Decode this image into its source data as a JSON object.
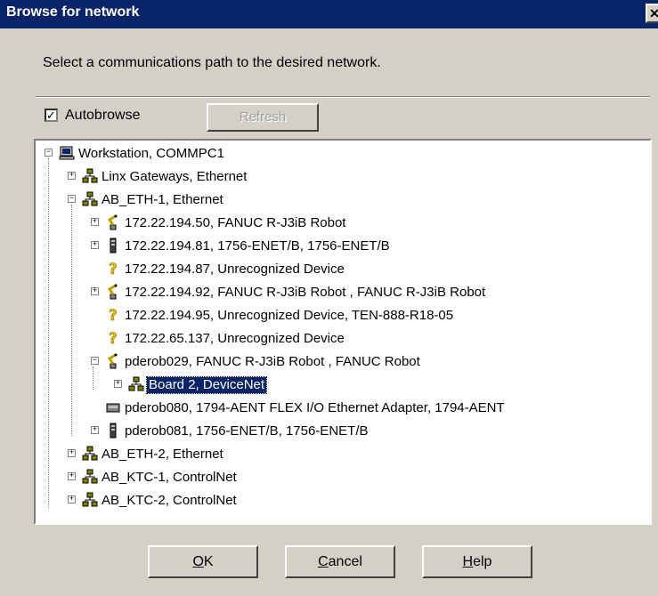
{
  "window": {
    "title": "Browse for network",
    "instruction": "Select a communications path to the desired network."
  },
  "options": {
    "autobrowse_label": "Autobrowse",
    "autobrowse_checked": true,
    "refresh_label": "Refresh"
  },
  "tree": {
    "nodes": [
      {
        "label": "Workstation, COMMPC1",
        "icon": "computer-icon",
        "expander": "minus"
      },
      {
        "label": "Linx Gateways, Ethernet",
        "icon": "network-icon",
        "expander": "plus"
      },
      {
        "label": "AB_ETH-1, Ethernet",
        "icon": "network-icon",
        "expander": "minus"
      },
      {
        "label": "172.22.194.50, FANUC R-J3iB Robot",
        "icon": "robot-icon",
        "expander": "plus"
      },
      {
        "label": "172.22.194.81, 1756-ENET/B, 1756-ENET/B",
        "icon": "module-icon",
        "expander": "plus"
      },
      {
        "label": "172.22.194.87, Unrecognized Device",
        "icon": "unknown-device-icon",
        "expander": ""
      },
      {
        "label": "172.22.194.92, FANUC R-J3iB Robot , FANUC R-J3iB Robot",
        "icon": "robot-icon",
        "expander": "plus"
      },
      {
        "label": "172.22.194.95, Unrecognized Device, TEN-888-R18-05",
        "icon": "unknown-device-icon",
        "expander": ""
      },
      {
        "label": "172.22.65.137, Unrecognized Device",
        "icon": "unknown-device-icon",
        "expander": ""
      },
      {
        "label": "pderob029, FANUC R-J3iB Robot , FANUC Robot",
        "icon": "robot-icon",
        "expander": "minus"
      },
      {
        "label": "Board 2, DeviceNet",
        "icon": "network-icon",
        "expander": "plus",
        "selected": true
      },
      {
        "label": "pderob080, 1794-AENT FLEX I/O Ethernet Adapter, 1794-AENT",
        "icon": "adapter-icon",
        "expander": ""
      },
      {
        "label": "pderob081, 1756-ENET/B, 1756-ENET/B",
        "icon": "module-icon",
        "expander": "plus"
      },
      {
        "label": "AB_ETH-2, Ethernet",
        "icon": "network-icon",
        "expander": "plus"
      },
      {
        "label": "AB_KTC-1, ControlNet",
        "icon": "network-icon",
        "expander": "plus"
      },
      {
        "label": "AB_KTC-2, ControlNet",
        "icon": "network-icon",
        "expander": "plus"
      }
    ]
  },
  "buttons": {
    "ok_mnemonic": "O",
    "ok_rest": "K",
    "cancel_mnemonic": "C",
    "cancel_rest": "ancel",
    "help_mnemonic": "H",
    "help_rest": "elp"
  },
  "colors": {
    "titlebar": "#0a246a",
    "dialog_face": "#d4d0c8",
    "selection": "#0a246a"
  }
}
